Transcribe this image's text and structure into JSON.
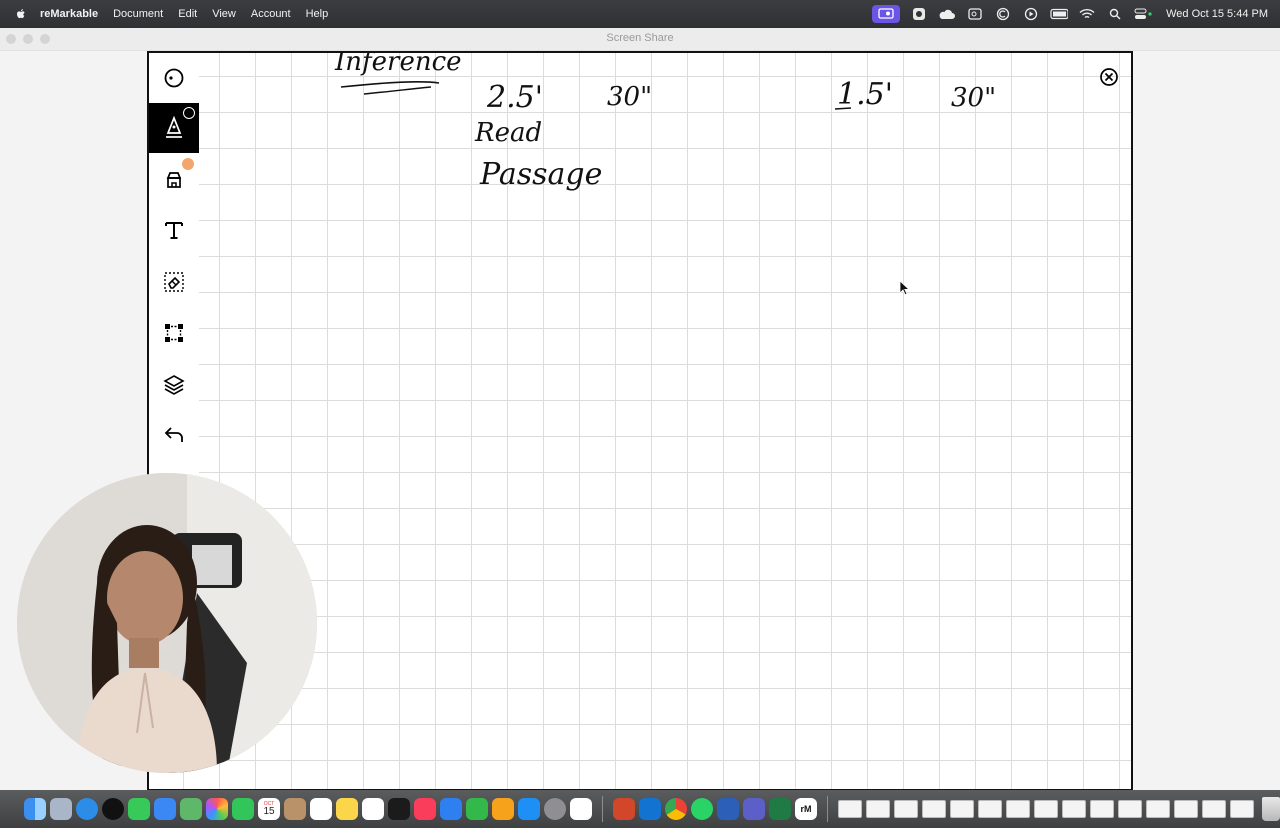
{
  "menubar": {
    "app_name": "reMarkable",
    "menus": [
      "Document",
      "Edit",
      "View",
      "Account",
      "Help"
    ],
    "clock": "Wed Oct 15  5:44 PM"
  },
  "window": {
    "title": "Screen Share"
  },
  "canvas": {
    "tools": [
      "navigation-menu",
      "pen",
      "highlighter",
      "text",
      "eraser",
      "selection",
      "layers",
      "undo"
    ],
    "selected_tool": "pen",
    "handwriting": [
      "Inference",
      "2.5'",
      "30\"",
      "Read",
      "Passage",
      "1.5'",
      "30\""
    ]
  },
  "dock": {
    "apps": [
      "Finder",
      "Launchpad",
      "Safari",
      "ChatGPT",
      "Messages",
      "Mail",
      "Maps",
      "Photos",
      "FaceTime",
      "Calendar",
      "Contacts",
      "Reminders",
      "Notes",
      "Freeform",
      "TV",
      "Music",
      "Keynote",
      "Numbers",
      "Pages",
      "App Store",
      "System Settings",
      "Zotero",
      "PowerPoint",
      "Outlook",
      "Chrome",
      "WhatsApp",
      "Word",
      "Teams",
      "Excel",
      "reMarkable"
    ],
    "calendar_day": "15",
    "calendar_month": "OCT",
    "rm_label": "rM"
  },
  "colors": {
    "menubar": "#2e3033",
    "canvas_grid": "#dcdcdc",
    "highlighter_badge": "#f3a66b",
    "screen_share_indicator": "#6b55e6"
  }
}
